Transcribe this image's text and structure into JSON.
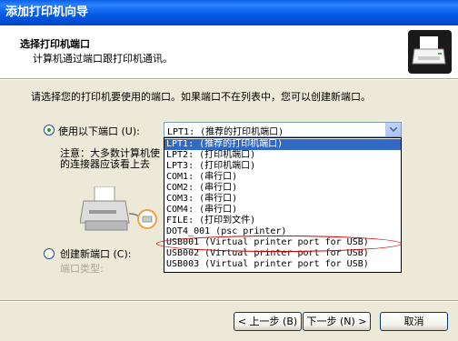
{
  "window": {
    "title": "添加打印机向导"
  },
  "header": {
    "title": "选择打印机端口",
    "subtitle": "计算机通过端口跟打印机通讯。"
  },
  "instruction": "请选择您的打印机要使用的端口。如果端口不在列表中，您可以创建新端口。",
  "use_port": {
    "label": "使用以下端口 (U):",
    "selected": true
  },
  "combo": {
    "value": "LPT1:  (推荐的打印机端口)"
  },
  "note": {
    "line1": "注意：大多数计算机使",
    "line2": "的连接器应该看上去"
  },
  "create_port": {
    "label": "创建新端口 (C):",
    "selected": false,
    "type_label": "端口类型:"
  },
  "dropdown": {
    "items": [
      "LPT1:  (推荐的打印机端口)",
      "LPT2:  (打印机端口)",
      "LPT3:  (打印机端口)",
      "COM1:  (串行口)",
      "COM2:  (串行口)",
      "COM3:  (串行口)",
      "COM4:  (串行口)",
      "FILE:  (打印到文件)",
      "DOT4_001  (psc printer)",
      "USB001  (Virtual printer port for USB)",
      "USB002  (Virtual printer port for USB)",
      "USB003  (Virtual printer port for USB)"
    ],
    "selected_index": 0
  },
  "buttons": {
    "back": "< 上一步 (B)",
    "next": "下一步 (N) >",
    "cancel": "取消"
  },
  "colors": {
    "accent": "#316ac5",
    "highlight_ellipse": "#cc0000",
    "titlebar": "#0058e3"
  }
}
